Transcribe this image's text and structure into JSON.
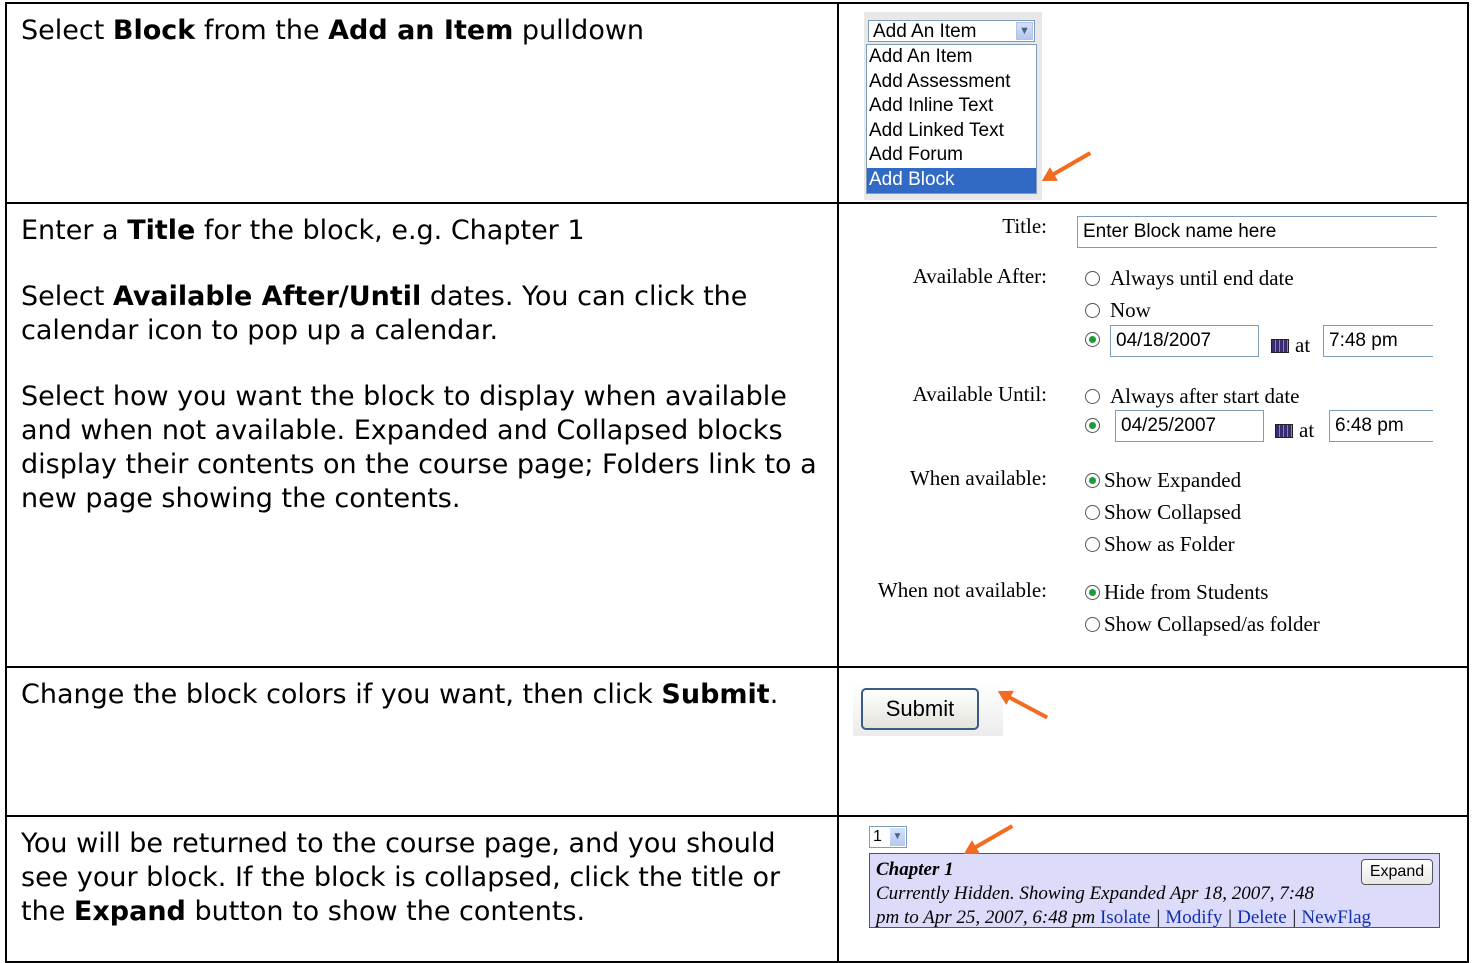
{
  "rows": [
    {
      "instructions": [
        {
          "parts": [
            "Select ",
            "Block",
            " from the ",
            "Add an Item",
            " pulldown"
          ]
        }
      ]
    },
    {
      "instructions": [
        {
          "parts": [
            "Enter a ",
            "Title",
            " for the block, e.g. Chapter 1"
          ]
        },
        {
          "parts": [
            "Select ",
            "Available After/Until",
            " dates.  You can click the calendar icon to pop up a calendar."
          ]
        },
        {
          "parts": [
            "Select how you want the block to display when available and when not available.  Expanded and Collapsed blocks display their contents on the course page; Folders link to a new page showing the contents."
          ]
        }
      ]
    },
    {
      "instructions": [
        {
          "parts": [
            "Change the block colors if you want, then click ",
            "Submit",
            "."
          ]
        }
      ]
    },
    {
      "instructions": [
        {
          "parts": [
            "You will be returned to the course page, and you should see your block.  If the block is collapsed, click the title or the ",
            "Expand",
            " button to show the contents."
          ]
        }
      ]
    }
  ],
  "dropdown": {
    "selected": "Add An Item",
    "options": [
      "Add An Item",
      "Add Assessment",
      "Add Inline Text",
      "Add Linked Text",
      "Add Forum",
      "Add Block"
    ],
    "highlighted": "Add Block"
  },
  "form": {
    "title_label": "Title:",
    "title_value": "Enter Block name here",
    "after_label": "Available After:",
    "after_options": [
      "Always until end date",
      "Now"
    ],
    "after_date": "04/18/2007",
    "after_time": "7:48 pm",
    "until_label": "Available Until:",
    "until_option": "Always after start date",
    "until_date": "04/25/2007",
    "until_time": "6:48 pm",
    "at_label": "at",
    "when_available_label": "When available:",
    "when_available_options": [
      "Show Expanded",
      "Show Collapsed",
      "Show as Folder"
    ],
    "when_not_available_label": "When not available:",
    "when_not_available_options": [
      "Hide from Students",
      "Show Collapsed/as folder"
    ]
  },
  "submit": {
    "label": "Submit"
  },
  "course_block": {
    "page_select": "1",
    "title": "Chapter 1",
    "status_line1": "Currently Hidden. Showing Expanded Apr 18, 2007, 7:48",
    "status_line2": "pm to Apr 25, 2007, 6:48 pm",
    "links": [
      "Isolate",
      "Modify",
      "Delete",
      "NewFlag"
    ],
    "expand_label": "Expand"
  },
  "colors": {
    "arrow": "#f26b21",
    "highlight": "#316ac5",
    "block_bg": "#dcdcfa"
  }
}
